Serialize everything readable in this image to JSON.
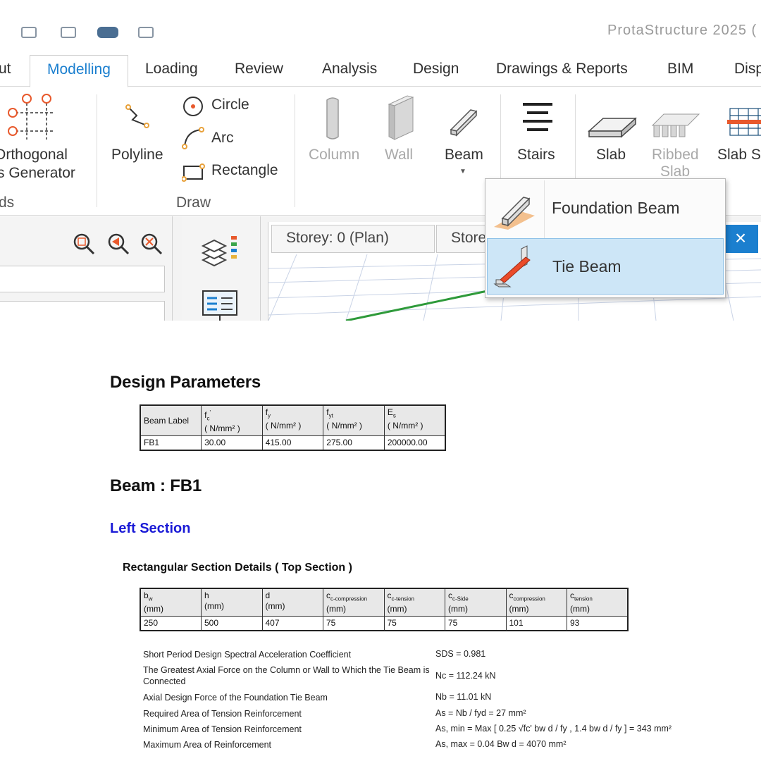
{
  "app": {
    "title": "ProtaStructure 2025 (",
    "tabs": [
      {
        "label": "ut"
      },
      {
        "label": "Modelling"
      },
      {
        "label": "Loading"
      },
      {
        "label": "Review"
      },
      {
        "label": "Analysis"
      },
      {
        "label": "Design"
      },
      {
        "label": "Drawings & Reports"
      },
      {
        "label": "BIM"
      },
      {
        "label": "Disp"
      }
    ],
    "ribbon": {
      "orthogonal_line1": "Orthogonal",
      "orthogonal_line2": "s Generator",
      "grids_group": "ds",
      "polyline": "Polyline",
      "circle": "Circle",
      "arc": "Arc",
      "rectangle": "Rectangle",
      "draw_group": "Draw",
      "column": "Column",
      "wall": "Wall",
      "beam": "Beam",
      "stairs": "Stairs",
      "slab": "Slab",
      "ribbed_slab_line1": "Ribbed",
      "ribbed_slab_line2": "Slab",
      "slab_st": "Slab St"
    },
    "viewport": {
      "tab1": "Storey: 0 (Plan)",
      "tab2": "Store",
      "close": "×"
    },
    "beam_menu": {
      "items": [
        {
          "label": "Foundation Beam"
        },
        {
          "label": "Tie Beam"
        }
      ]
    }
  },
  "report": {
    "design_parameters_title": "Design Parameters",
    "design_table": {
      "headers": [
        "Beam Label",
        "fc'",
        "fy",
        "fyt",
        "Es"
      ],
      "unit": "( N/mm² )",
      "row": [
        "FB1",
        "30.00",
        "415.00",
        "275.00",
        "200000.00"
      ]
    },
    "beam_title": "Beam : FB1",
    "left_section": "Left Section",
    "section_details_title": "Rectangular Section Details ( Top Section )",
    "section_table": {
      "headers": [
        {
          "sym": "b",
          "sub": "w",
          "unit": "(mm)"
        },
        {
          "sym": "h",
          "sub": "",
          "unit": "(mm)"
        },
        {
          "sym": "d",
          "sub": "",
          "unit": "(mm)"
        },
        {
          "sym": "c",
          "sub": "c-compression",
          "unit": "(mm)"
        },
        {
          "sym": "c",
          "sub": "c-tension",
          "unit": "(mm)"
        },
        {
          "sym": "c",
          "sub": "c-Side",
          "unit": "(mm)"
        },
        {
          "sym": "c",
          "sub": "compression",
          "unit": "(mm)"
        },
        {
          "sym": "c",
          "sub": "tension",
          "unit": "(mm)"
        }
      ],
      "row": [
        "250",
        "500",
        "407",
        "75",
        "75",
        "75",
        "101",
        "93"
      ]
    },
    "calcs": [
      {
        "desc": "Short Period Design Spectral Acceleration Coefficient",
        "eq": "SDS = 0.981"
      },
      {
        "desc": "The Greatest Axial Force on the Column or Wall to Which the Tie Beam is Connected",
        "eq": "Nc = 112.24 kN"
      },
      {
        "desc": "Axial Design Force of the Foundation Tie Beam",
        "eq": "Nb = 11.01 kN"
      },
      {
        "desc": "Required Area of Tension Reinforcement",
        "eq": "As = Nb / fyd  =  27 mm²"
      },
      {
        "desc": "Minimum Area of Tension Reinforcement",
        "eq": "As, min = Max [ 0.25 √fc' bw d / fy , 1.4 bw d / fy ]  =  343 mm²"
      },
      {
        "desc": "Maximum Area of Reinforcement",
        "eq": "As, max = 0.04 Bw d  =  4070 mm²"
      }
    ]
  }
}
